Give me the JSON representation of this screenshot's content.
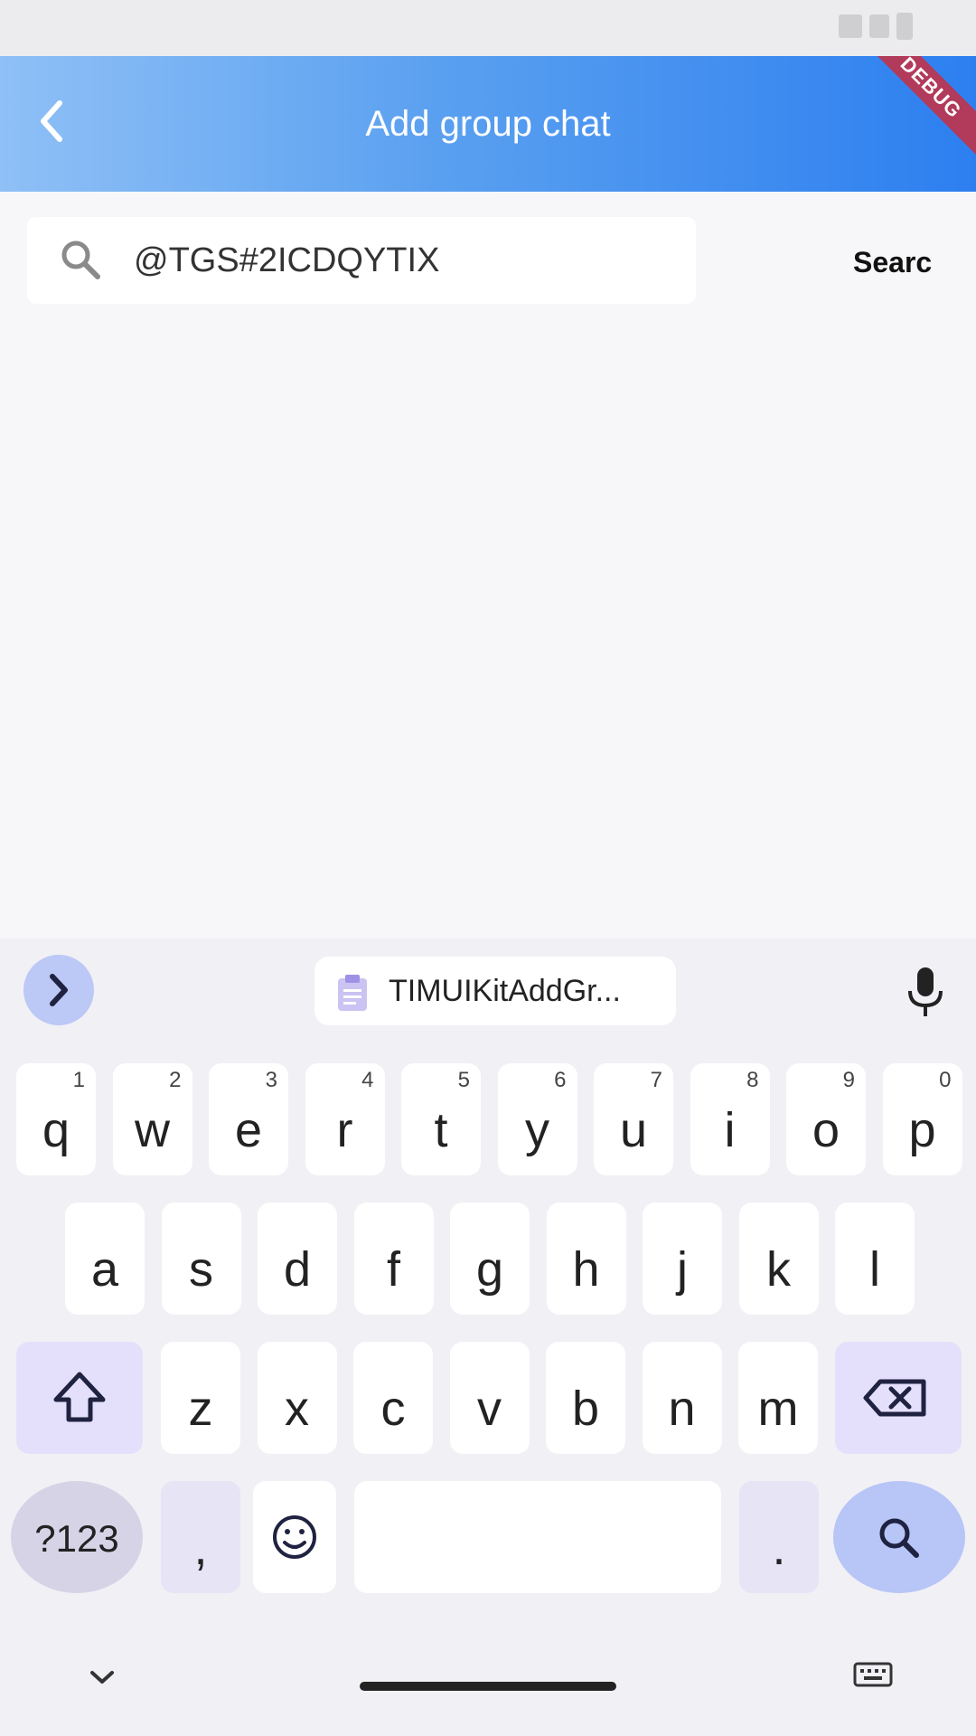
{
  "app_bar": {
    "title": "Add group chat",
    "debug_label": "DEBUG",
    "accent_start": "#8fc0f6",
    "accent_end": "#2d7ff0"
  },
  "search": {
    "value": "@TGS#2ICDQYTIX",
    "action_label": "Searc"
  },
  "keyboard": {
    "clipboard_suggestion": "TIMUIKitAddGr...",
    "row1": [
      {
        "ch": "q",
        "hint": "1"
      },
      {
        "ch": "w",
        "hint": "2"
      },
      {
        "ch": "e",
        "hint": "3"
      },
      {
        "ch": "r",
        "hint": "4"
      },
      {
        "ch": "t",
        "hint": "5"
      },
      {
        "ch": "y",
        "hint": "6"
      },
      {
        "ch": "u",
        "hint": "7"
      },
      {
        "ch": "i",
        "hint": "8"
      },
      {
        "ch": "o",
        "hint": "9"
      },
      {
        "ch": "p",
        "hint": "0"
      }
    ],
    "row2": [
      "a",
      "s",
      "d",
      "f",
      "g",
      "h",
      "j",
      "k",
      "l"
    ],
    "row3": [
      "z",
      "x",
      "c",
      "v",
      "b",
      "n",
      "m"
    ],
    "num_label": "?123",
    "comma_label": ",",
    "period_label": ".",
    "icons": {
      "shift": "shift-icon",
      "backspace": "backspace-icon",
      "emoji": "emoji-icon",
      "search": "search-icon",
      "mic": "mic-icon",
      "clipboard": "clipboard-icon"
    }
  }
}
